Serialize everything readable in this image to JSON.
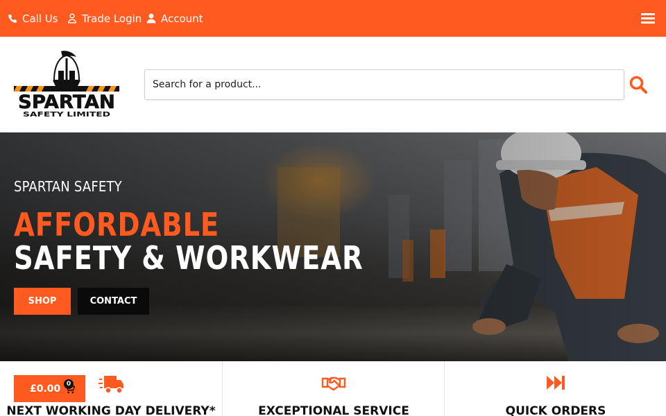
{
  "topbar": {
    "call_label": "Call Us",
    "trade_label": "Trade Login",
    "account_label": "Account"
  },
  "header": {
    "logo_text": "SPARTAN",
    "logo_subtext": "SAFETY LIMITED",
    "search_placeholder": "Search for a product..."
  },
  "hero": {
    "kicker": "SPARTAN SAFETY",
    "title_line1": "AFFORDABLE",
    "title_line2": "SAFETY & WORKWEAR",
    "shop_label": "SHOP",
    "contact_label": "CONTACT"
  },
  "features": [
    {
      "title": "NEXT WORKING DAY DELIVERY*",
      "icon": "delivery-truck-icon"
    },
    {
      "title": "EXCEPTIONAL SERVICE",
      "icon": "handshake-icon"
    },
    {
      "title": "QUICK ORDERS",
      "icon": "fast-forward-icon"
    }
  ],
  "cart": {
    "total": "£0.00",
    "count": "0"
  },
  "colors": {
    "brand_orange": "#ff5a1f",
    "black": "#0a0a0a",
    "white": "#ffffff"
  }
}
